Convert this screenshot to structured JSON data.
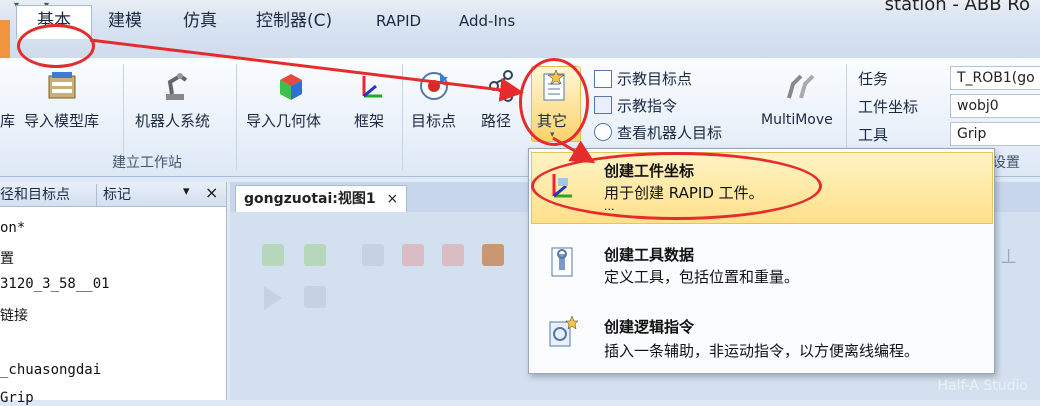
{
  "window": {
    "title": "station - ABB Ro"
  },
  "tabs": [
    {
      "label": "基本"
    },
    {
      "label": "建模"
    },
    {
      "label": "仿真"
    },
    {
      "label": "控制器(C)"
    },
    {
      "label": "RAPID"
    },
    {
      "label": "Add-Ins"
    }
  ],
  "ribbon": {
    "buttons": {
      "cut_label": "库",
      "import_model_lib": "导入模型库",
      "robot_system": "机器人系统",
      "import_geometry": "导入几何体",
      "frame": "框架",
      "target": "目标点",
      "path": "路径",
      "other": "其它",
      "multimove": "MultiMove"
    },
    "small_buttons": [
      "示教目标点",
      "示教指令",
      "查看机器人目标"
    ],
    "settings": {
      "task_label": "任务",
      "task_value": "T_ROB1(go",
      "wobj_label": "工件坐标",
      "wobj_value": "wobj0",
      "tool_label": "工具",
      "tool_value": "Grip"
    },
    "groups": {
      "build_station": "建立工作站",
      "settings_partial": "设置"
    }
  },
  "left_panel": {
    "tabs": [
      "径和目标点",
      "标记"
    ],
    "pin": "▾",
    "close": "×",
    "tree": [
      "on*",
      "置",
      "3120_3_58__01",
      "链接",
      "_chuasongdai",
      "Grip"
    ]
  },
  "document": {
    "tab_label": "gongzuotai:视图1",
    "close": "×"
  },
  "dropdown": {
    "items": [
      {
        "title": "创建工件坐标",
        "desc": "用于创建 RAPID 工件。",
        "extra": "..."
      },
      {
        "title": "创建工具数据",
        "desc": "定义工具，包括位置和重量。"
      },
      {
        "title": "创建逻辑指令",
        "desc": "插入一条辅助，非运动指令，以方便离线编程。"
      }
    ]
  },
  "watermark": "Half-A Studio",
  "colors": {
    "annotation": "#e52b2b",
    "highlight": "#fde08a",
    "accent_tab": "#f1943d"
  }
}
